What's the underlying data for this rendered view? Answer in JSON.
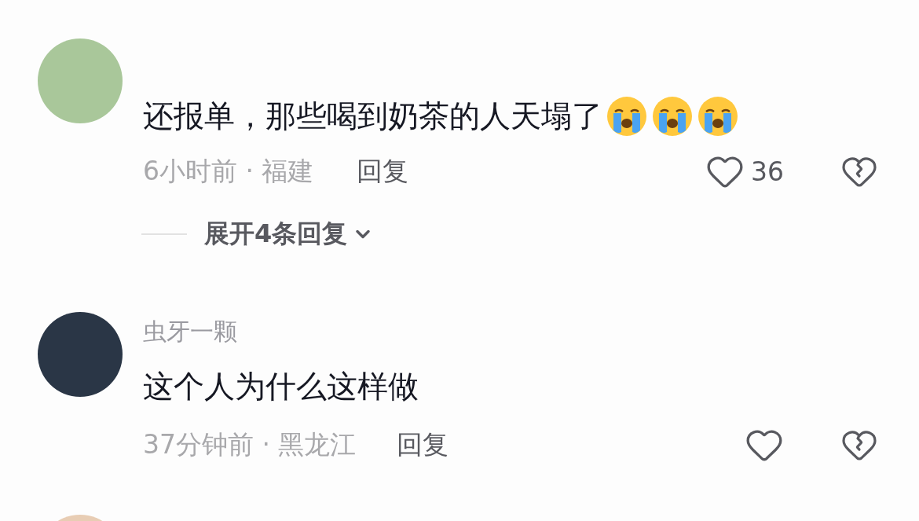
{
  "comments": [
    {
      "text": "还报单，那些喝到奶茶的人天塌了",
      "emojis": [
        {
          "kind": "crying"
        },
        {
          "kind": "crying"
        },
        {
          "kind": "crying"
        }
      ],
      "meta": "6小时前 · 福建",
      "reply": "回复",
      "likes": "36",
      "expand": "展开4条回复"
    },
    {
      "username": "虫牙一颗",
      "text": "这个人为什么这样做",
      "meta": "37分钟前 · 黑龙江",
      "reply": "回复"
    }
  ],
  "more_below": true
}
